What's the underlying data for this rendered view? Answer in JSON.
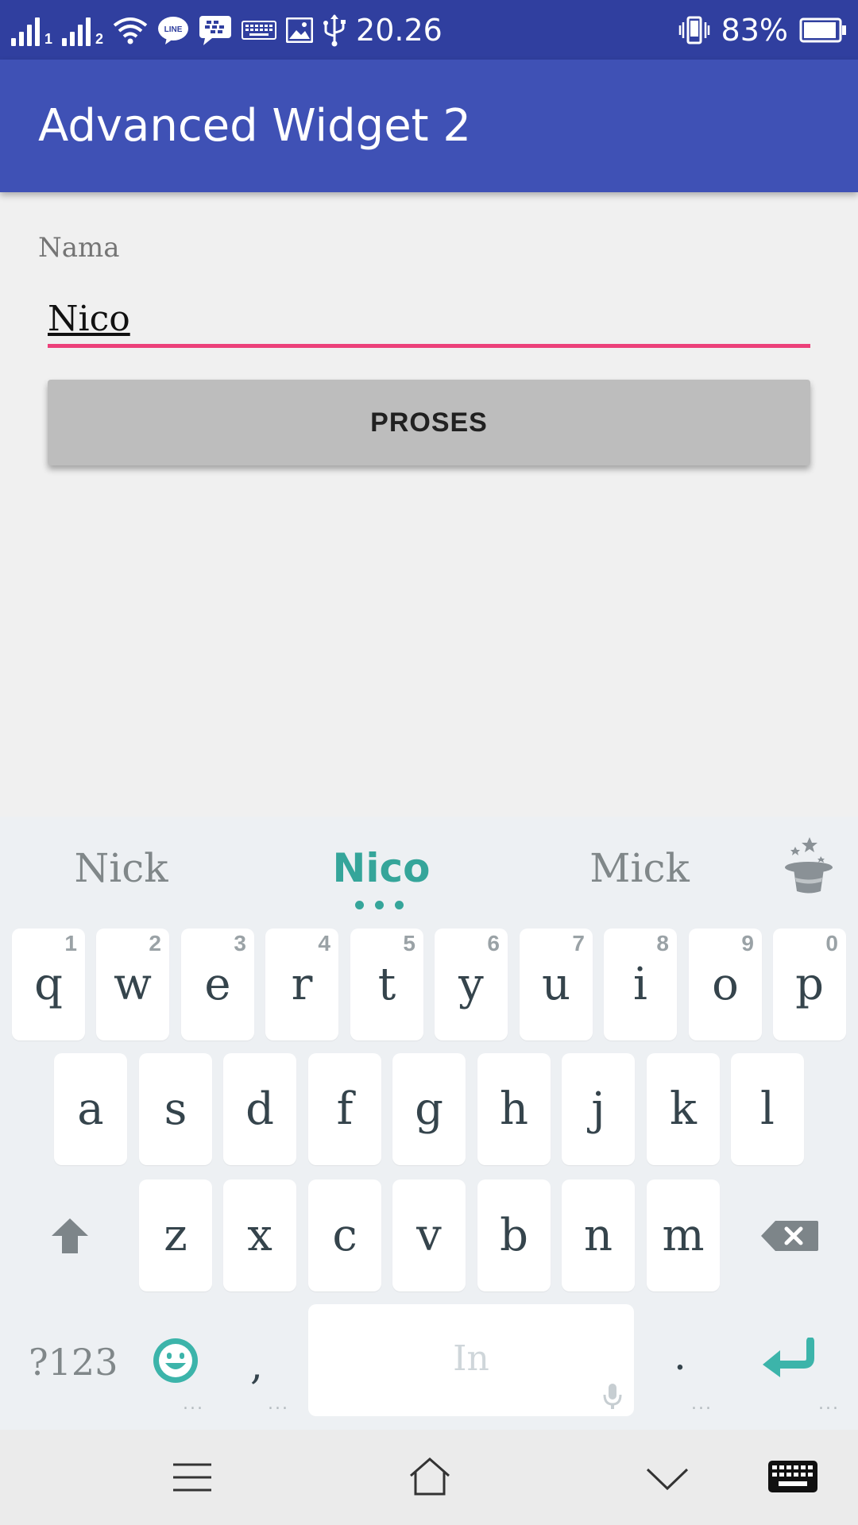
{
  "status_bar": {
    "sim1": "1",
    "sim2": "2",
    "line_label": "LINE",
    "time": "20.26",
    "battery": "83%"
  },
  "app_bar": {
    "title": "Advanced Widget 2"
  },
  "form": {
    "name_label": "Nama",
    "name_value": "Nico",
    "button_label": "PROSES"
  },
  "keyboard": {
    "suggestions": [
      "Nick",
      "Nico",
      "Mick"
    ],
    "row1": [
      {
        "letter": "q",
        "num": "1"
      },
      {
        "letter": "w",
        "num": "2"
      },
      {
        "letter": "e",
        "num": "3"
      },
      {
        "letter": "r",
        "num": "4"
      },
      {
        "letter": "t",
        "num": "5"
      },
      {
        "letter": "y",
        "num": "6"
      },
      {
        "letter": "u",
        "num": "7"
      },
      {
        "letter": "i",
        "num": "8"
      },
      {
        "letter": "o",
        "num": "9"
      },
      {
        "letter": "p",
        "num": "0"
      }
    ],
    "row2": [
      "a",
      "s",
      "d",
      "f",
      "g",
      "h",
      "j",
      "k",
      "l"
    ],
    "row3": [
      "z",
      "x",
      "c",
      "v",
      "b",
      "n",
      "m"
    ],
    "symbols_label": "?123",
    "comma": ",",
    "period": ".",
    "space_label": "In",
    "ellipsis": "..."
  },
  "colors": {
    "status_bar": "#303f9f",
    "app_bar": "#3f51b5",
    "accent": "#ec407a",
    "suggestion_active": "#35a59a"
  },
  "icons": {
    "shift": "shift-icon",
    "backspace": "backspace-icon",
    "emoji": "emoji-icon",
    "enter": "enter-icon",
    "mic": "mic-icon",
    "magic": "magic-hat-icon",
    "nav_menu": "menu-icon",
    "nav_home": "home-icon",
    "nav_back": "chevron-down-icon",
    "nav_keyboard": "keyboard-icon"
  }
}
